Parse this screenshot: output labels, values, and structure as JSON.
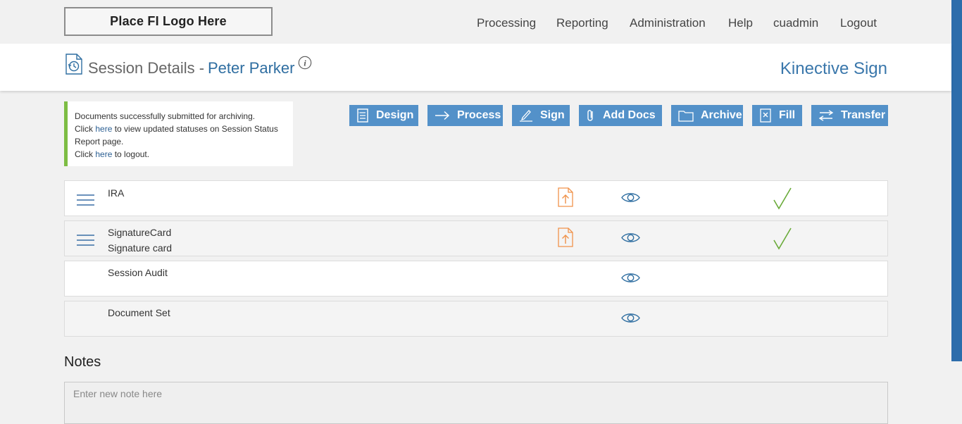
{
  "header": {
    "logo_text": "Place FI Logo Here",
    "nav": [
      {
        "label": "Processing"
      },
      {
        "label": "Reporting"
      },
      {
        "label": "Administration"
      },
      {
        "label": "Help"
      },
      {
        "label": "cuadmin"
      },
      {
        "label": "Logout"
      }
    ]
  },
  "session": {
    "title": "Session Details -",
    "name": "Peter Parker",
    "brand": "Kinective Sign"
  },
  "message": {
    "line1": "Documents successfully submitted for archiving.",
    "line2_prefix": "Click ",
    "line2_link": "here",
    "line2_suffix": " to view updated statuses on Session Status Report page.",
    "line3_prefix": "Click ",
    "line3_link": "here",
    "line3_suffix": " to logout."
  },
  "toolbar": [
    {
      "label": "Design",
      "icon": "list-document-icon"
    },
    {
      "label": "Process",
      "icon": "arrow-right-icon"
    },
    {
      "label": "Sign",
      "icon": "pen-icon"
    },
    {
      "label": "Add Docs",
      "icon": "paperclip-icon"
    },
    {
      "label": "Archive",
      "icon": "folder-icon"
    },
    {
      "label": "Fill",
      "icon": "form-document-icon"
    },
    {
      "label": "Transfer",
      "icon": "transfer-arrows-icon"
    }
  ],
  "documents": [
    {
      "name": "IRA",
      "subtitle": "",
      "has_menu": true,
      "has_upload": true,
      "has_view": true,
      "signed": true
    },
    {
      "name": "SignatureCard",
      "subtitle": "Signature card",
      "has_menu": true,
      "has_upload": true,
      "has_view": true,
      "signed": true
    },
    {
      "name": "Session Audit",
      "subtitle": "",
      "has_menu": false,
      "has_upload": false,
      "has_view": true,
      "signed": false
    },
    {
      "name": "Document Set",
      "subtitle": "",
      "has_menu": false,
      "has_upload": false,
      "has_view": true,
      "signed": false
    }
  ],
  "notes": {
    "heading": "Notes",
    "placeholder": "Enter new note here"
  },
  "colors": {
    "accent_blue": "#5391c9",
    "title_blue": "#2f6ea1",
    "success_green": "#7dbd44",
    "upload_orange": "#f0924a",
    "scrollbar_blue": "#2d6dab"
  }
}
